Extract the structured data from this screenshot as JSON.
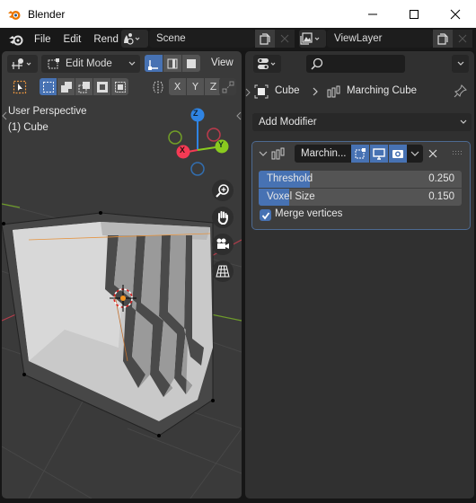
{
  "window": {
    "title": "Blender",
    "controls": [
      "minimize",
      "maximize",
      "close"
    ]
  },
  "topbar": {
    "menus": [
      "File",
      "Edit",
      "Rend"
    ],
    "scene": {
      "value": "Scene"
    },
    "view_layer": {
      "value": "ViewLayer"
    }
  },
  "viewport": {
    "header": {
      "mode": "Edit Mode",
      "view_menu": "View",
      "select_modes": [
        "vertex",
        "edge",
        "face"
      ],
      "active_select_mode": "vertex",
      "mirror_axes": [
        "X",
        "Y",
        "Z"
      ]
    },
    "overlay_text": {
      "perspective": "User Perspective",
      "object": "(1) Cube"
    },
    "gizmo_axes": [
      "Z",
      "Y",
      "X"
    ],
    "nav_buttons": [
      "zoom",
      "pan",
      "camera",
      "ortho-toggle"
    ],
    "colors": {
      "x_axis": "#f53a54",
      "y_axis": "#8acb1f",
      "z_axis": "#2f84e3",
      "selected_edge": "#e59440"
    }
  },
  "properties": {
    "search": {
      "placeholder": ""
    },
    "breadcrumb": {
      "object": "Cube",
      "modifier": "Marching Cube"
    },
    "add_modifier_label": "Add Modifier",
    "modifier": {
      "name": "Marchin...",
      "toggles": [
        "edit-mode",
        "viewport",
        "render"
      ],
      "fields": [
        {
          "label": "Threshold",
          "value": "0.250",
          "fill": 0.25
        },
        {
          "label": "Voxel Size",
          "value": "0.150",
          "fill": 0.15
        }
      ],
      "merge_vertices": {
        "label": "Merge vertices",
        "checked": true
      }
    },
    "accent": "#4772b3"
  }
}
